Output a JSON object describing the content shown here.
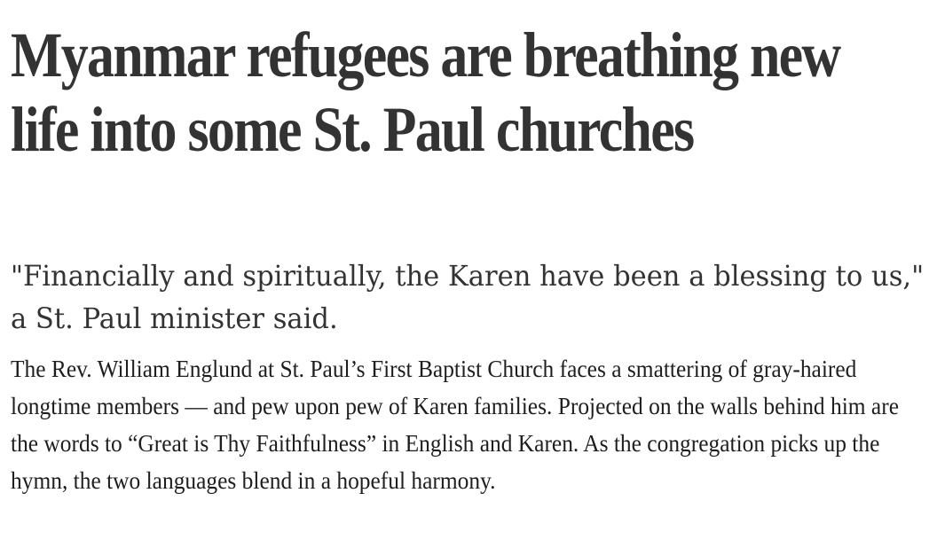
{
  "article": {
    "headline": "Myanmar refugees are breathing new life into some St. Paul churches",
    "dek": "\"Financially and spiritually, the Karen have been a blessing to us,\" a St. Paul minister said.",
    "body": "The Rev. William Englund at St. Paul’s First Baptist Church faces a smattering of gray-haired longtime members — and pew upon pew of Karen families. Projected on the walls behind him are the words to “Great is Thy Faithfulness” in English and Karen. As the congregation picks up the hymn, the two languages blend in a hopeful harmony."
  }
}
